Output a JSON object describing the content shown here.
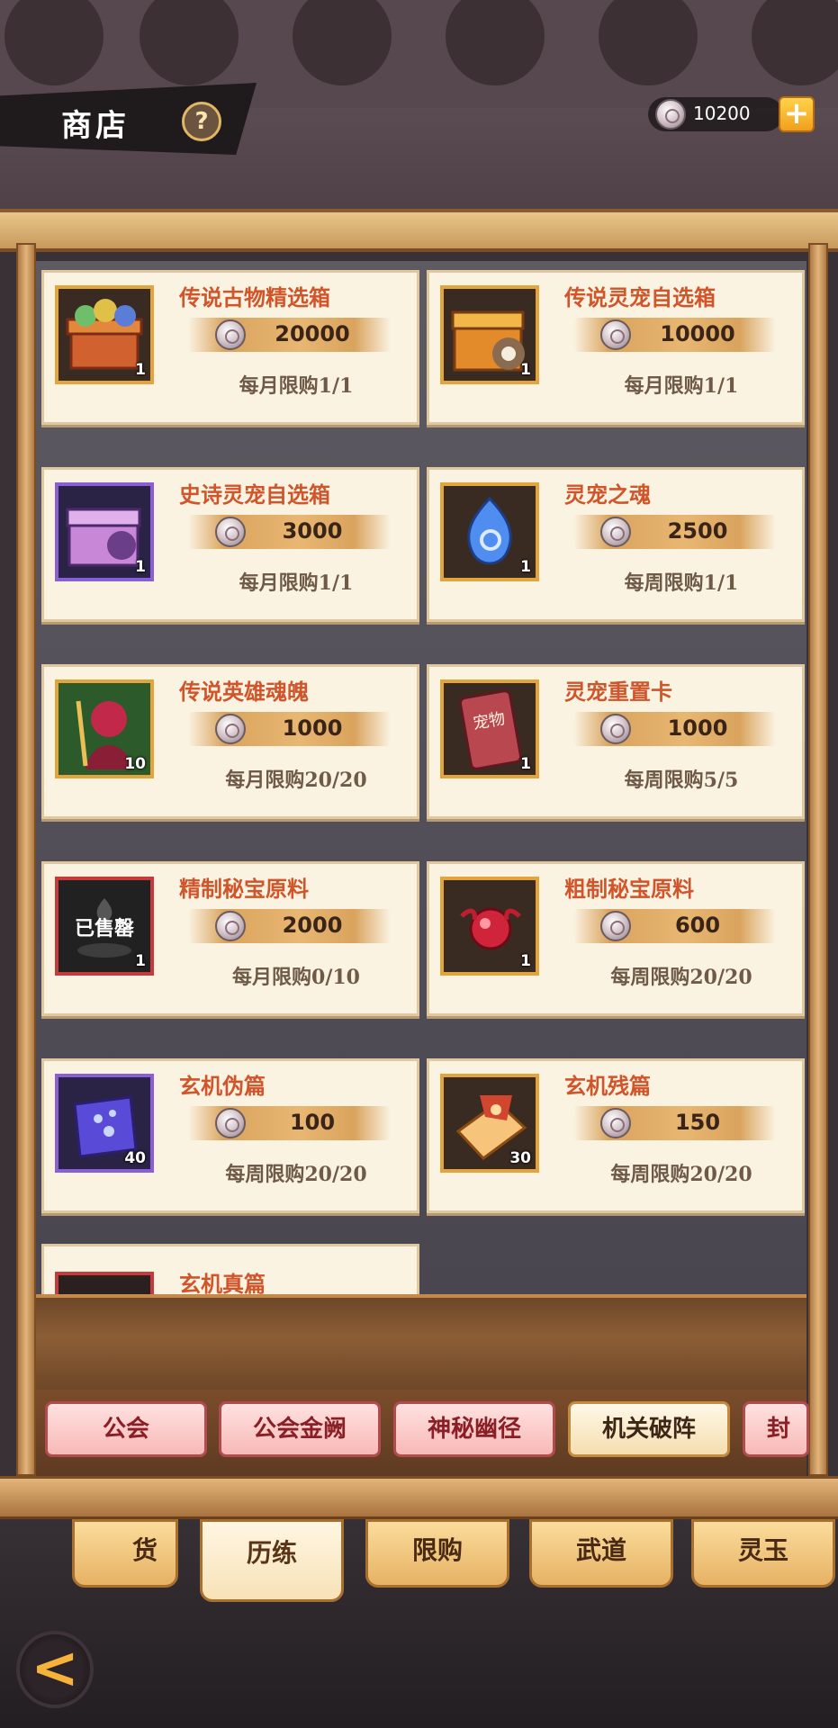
{
  "header": {
    "title": "商店",
    "help_label": "?",
    "currency_value": "10200",
    "add_label": "+"
  },
  "shop_items": [
    {
      "name": "传说古物精选箱",
      "price": "20000",
      "limit": "每月限购1/1",
      "qty": "1",
      "frame": "gold",
      "icon": "treasure-chest-icon"
    },
    {
      "name": "传说灵宠自选箱",
      "price": "10000",
      "limit": "每月限购1/1",
      "qty": "1",
      "frame": "gold",
      "icon": "pet-chest-icon"
    },
    {
      "name": "史诗灵宠自选箱",
      "price": "3000",
      "limit": "每月限购1/1",
      "qty": "1",
      "frame": "purple",
      "icon": "purple-chest-icon"
    },
    {
      "name": "灵宠之魂",
      "price": "2500",
      "limit": "每周限购1/1",
      "qty": "1",
      "frame": "gold",
      "icon": "blue-soul-gem-icon"
    },
    {
      "name": "传说英雄魂魄",
      "price": "1000",
      "limit": "每月限购20/20",
      "qty": "10",
      "frame": "gold",
      "icon": "hero-soul-icon"
    },
    {
      "name": "灵宠重置卡",
      "price": "1000",
      "limit": "每周限购5/5",
      "qty": "1",
      "frame": "gold",
      "icon": "reset-card-icon",
      "card_text": "宠物"
    },
    {
      "name": "精制秘宝原料",
      "price": "2000",
      "limit": "每月限购0/10",
      "qty": "1",
      "frame": "red",
      "icon": "refined-material-icon",
      "sold_out": "已售罄"
    },
    {
      "name": "粗制秘宝原料",
      "price": "600",
      "limit": "每周限购20/20",
      "qty": "1",
      "frame": "gold",
      "icon": "red-orb-icon"
    },
    {
      "name": "玄机伪篇",
      "price": "100",
      "limit": "每周限购20/20",
      "qty": "40",
      "frame": "purple",
      "icon": "purple-scroll-icon"
    },
    {
      "name": "玄机残篇",
      "price": "150",
      "limit": "每周限购20/20",
      "qty": "30",
      "frame": "gold",
      "icon": "orange-scroll-icon"
    },
    {
      "name": "玄机真篇",
      "frame": "red",
      "icon": "red-scroll-icon"
    }
  ],
  "sub_tabs": [
    "公会",
    "公会金阙",
    "神秘幽径",
    "机关破阵",
    "封印"
  ],
  "sub_tab_active": "机关破阵",
  "main_tabs": [
    "货",
    "历练",
    "限购",
    "武道",
    "灵玉"
  ],
  "main_tab_active": "历练",
  "back_label": "<"
}
